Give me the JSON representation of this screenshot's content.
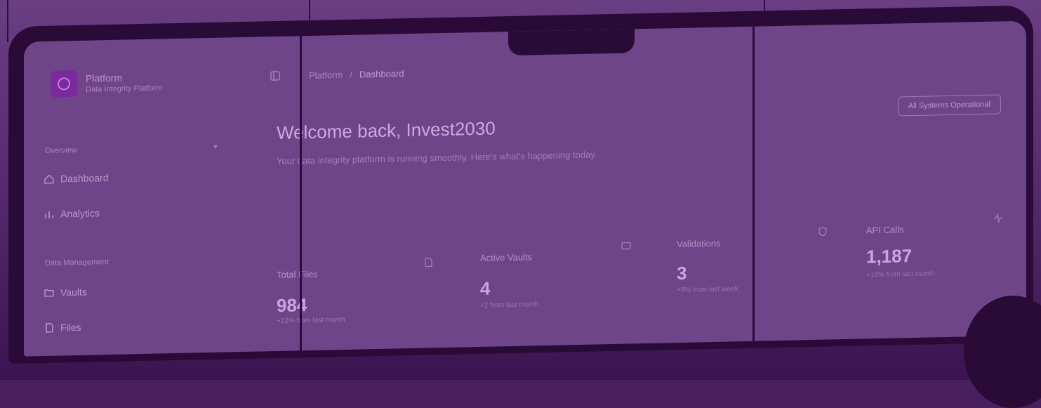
{
  "brand": {
    "name": "Platform",
    "subtitle": "Data Integrity Platform"
  },
  "sidebar": {
    "sections": [
      {
        "label": "Overview",
        "items": [
          {
            "label": "Dashboard",
            "icon": "home-icon"
          },
          {
            "label": "Analytics",
            "icon": "chart-icon"
          }
        ]
      },
      {
        "label": "Data Management",
        "items": [
          {
            "label": "Vaults",
            "icon": "folder-icon"
          },
          {
            "label": "Files",
            "icon": "file-icon"
          }
        ]
      }
    ]
  },
  "breadcrumb": {
    "parent": "Platform",
    "separator": "/",
    "current": "Dashboard"
  },
  "header": {
    "welcome": "Welcome back, Invest2030",
    "subtitle": "Your data integrity platform is running smoothly. Here's what's happening today.",
    "status_button": "All Systems Operational"
  },
  "stats": [
    {
      "label": "Total Files",
      "value": "984",
      "note": "+12% from last month",
      "icon": "file-icon"
    },
    {
      "label": "Active Vaults",
      "value": "4",
      "note": "+2 from last month",
      "icon": "vault-icon"
    },
    {
      "label": "Validations",
      "value": "3",
      "note": "+8% from last week",
      "icon": "shield-icon"
    },
    {
      "label": "API Calls",
      "value": "1,187",
      "note": "+15% from last month",
      "icon": "activity-icon"
    }
  ],
  "colors": {
    "accent": "#7a2a9e",
    "screen_tint": "#6e4589"
  }
}
